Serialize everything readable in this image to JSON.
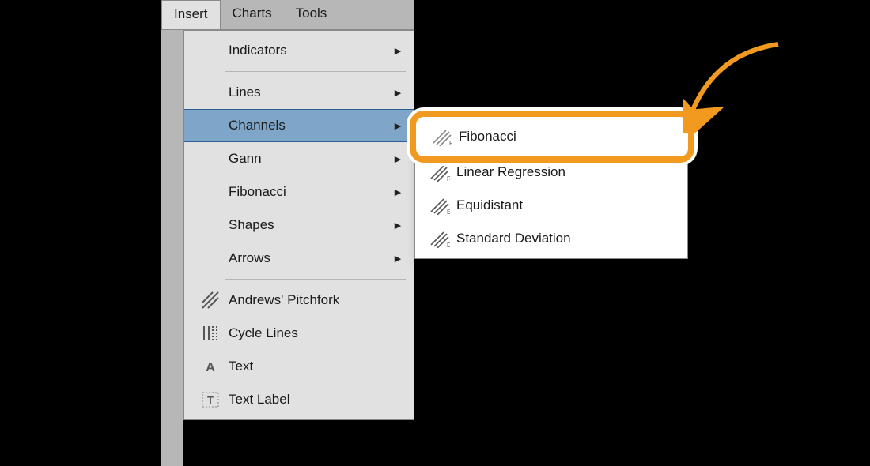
{
  "menu_bar": {
    "items": [
      "Insert",
      "Charts",
      "Tools"
    ],
    "active_index": 0
  },
  "dropdown": {
    "section1": [
      {
        "label": "Indicators",
        "has_sub": true
      }
    ],
    "section2": [
      {
        "label": "Lines",
        "has_sub": true
      },
      {
        "label": "Channels",
        "has_sub": true,
        "selected": true
      },
      {
        "label": "Gann",
        "has_sub": true
      },
      {
        "label": "Fibonacci",
        "has_sub": true
      },
      {
        "label": "Shapes",
        "has_sub": true
      },
      {
        "label": "Arrows",
        "has_sub": true
      }
    ],
    "section3": [
      {
        "label": "Andrews' Pitchfork",
        "icon": "pitchfork"
      },
      {
        "label": "Cycle Lines",
        "icon": "cycle"
      },
      {
        "label": "Text",
        "icon": "text"
      },
      {
        "label": "Text Label",
        "icon": "textlabel"
      }
    ]
  },
  "submenu": {
    "highlighted": {
      "label": "Fibonacci",
      "icon": "chan-f"
    },
    "items": [
      {
        "label": "Linear Regression",
        "icon": "chan-r"
      },
      {
        "label": "Equidistant",
        "icon": "chan-e"
      },
      {
        "label": "Standard Deviation",
        "icon": "chan-d"
      }
    ]
  },
  "annotation": {
    "arrow_color": "#f19a1f"
  }
}
